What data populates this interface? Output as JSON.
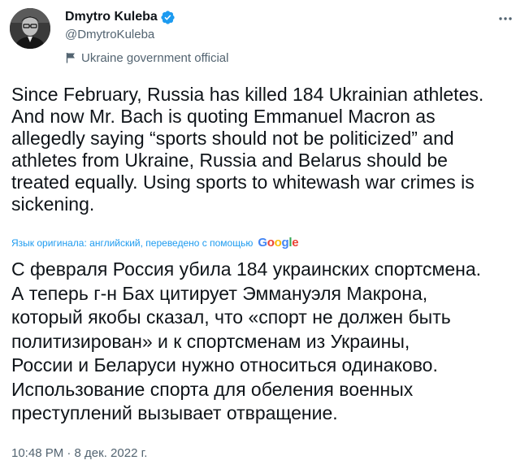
{
  "author": {
    "name": "Dmytro Kuleba",
    "handle": "@DmytroKuleba",
    "label": "Ukraine government official",
    "avatar_icon": "avatar-photo",
    "verified_color": "#1d9bf0"
  },
  "tweet": {
    "text": "Since February, Russia has killed 184 Ukrainian athletes.\nAnd now Mr. Bach is quoting Emmanuel Macron as\nallegedly saying “sports should not be politicized” and\nathletes from Ukraine, Russia and Belarus should be\ntreated equally. Using sports to whitewash war crimes is\nsickening.",
    "translation_note": "Язык оригинала: английский, переведено с помощью",
    "translation_provider": "Google",
    "translated_text": "С февраля Россия убила 184 украинских спортсмена.\nА теперь г-н Бах цитирует Эммануэля Макрона,\nкоторый якобы сказал, что «спорт не должен быть\nполитизирован» и к спортсменам из Украины,\nРоссии и Беларуси нужно относиться одинаково.\nИспользование спорта для обеления военных\nпреступлений вызывает отвращение.",
    "timestamp": "10:48 PM · 8 дек. 2022 г."
  },
  "icons": {
    "more": "more-icon",
    "flag": "government-flag-icon",
    "verified": "verified-badge-icon"
  },
  "colors": {
    "text": "#0f1419",
    "secondary": "#536471",
    "link": "#1d9bf0",
    "google_blue": "#4285f4",
    "google_red": "#ea4335",
    "google_yellow": "#fbbc05",
    "google_green": "#34a853"
  }
}
